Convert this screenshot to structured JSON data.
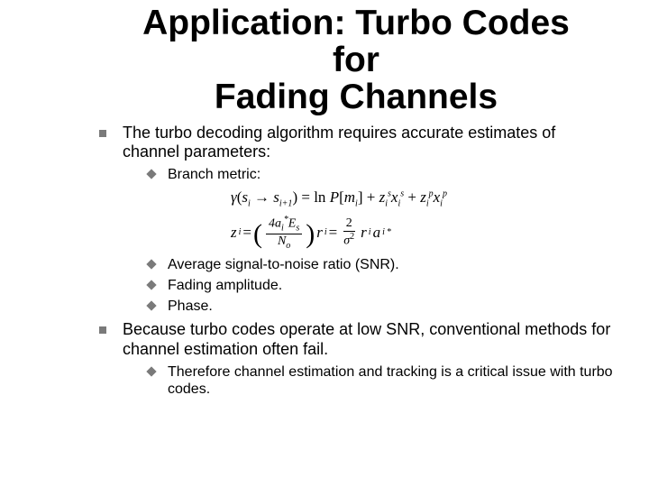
{
  "title_line1": "Application: Turbo Codes",
  "title_line2": "for",
  "title_line3": "Fading Channels",
  "bullets": {
    "b1": "The turbo decoding algorithm requires accurate estimates of channel parameters:",
    "b1a": "Branch metric:",
    "b1b": "Average signal-to-noise ratio (SNR).",
    "b1c": "Fading amplitude.",
    "b1d": "Phase.",
    "b2": "Because turbo codes operate at low SNR, conventional methods for channel estimation often fail.",
    "b2a": "Therefore channel estimation and tracking is a critical issue with turbo codes."
  },
  "formula": {
    "gamma": "γ",
    "lp": "(",
    "si": "s",
    "si_sub": "i",
    "arrow": " → ",
    "si1": "s",
    "si1_sub": "i+1",
    "rp": ")",
    "eq": " = ",
    "ln": "ln ",
    "P": "P",
    "lb": "[",
    "mi": "m",
    "mi_sub": "i",
    "rb": "]",
    "plus1": " + ",
    "zis": "z",
    "zis_sub": "i",
    "zis_sup": "s",
    "xis": "x",
    "xis_sub": "i",
    "xis_sup": "s",
    "plus2": " + ",
    "zip": "z",
    "zip_sub": "i",
    "zip_sup": "p",
    "xip": "x",
    "xip_sub": "i",
    "xip_sup": "p",
    "zi": "z",
    "zi_sub": "i",
    "eq2": " = ",
    "num1_a": "4a",
    "num1_a_sub": "i",
    "num1_a_sup": "*",
    "num1_b": "E",
    "num1_b_sub": "s",
    "den1": "N",
    "den1_sub": "o",
    "ri": "r",
    "ri_sub": "i",
    "eq3": " = ",
    "num2": "2",
    "den2": "σ",
    "den2_sup": "2",
    "ri2": "r",
    "ri2_sub": "i",
    "ai": "a",
    "ai_sub": "i",
    "ai_sup": "*"
  }
}
